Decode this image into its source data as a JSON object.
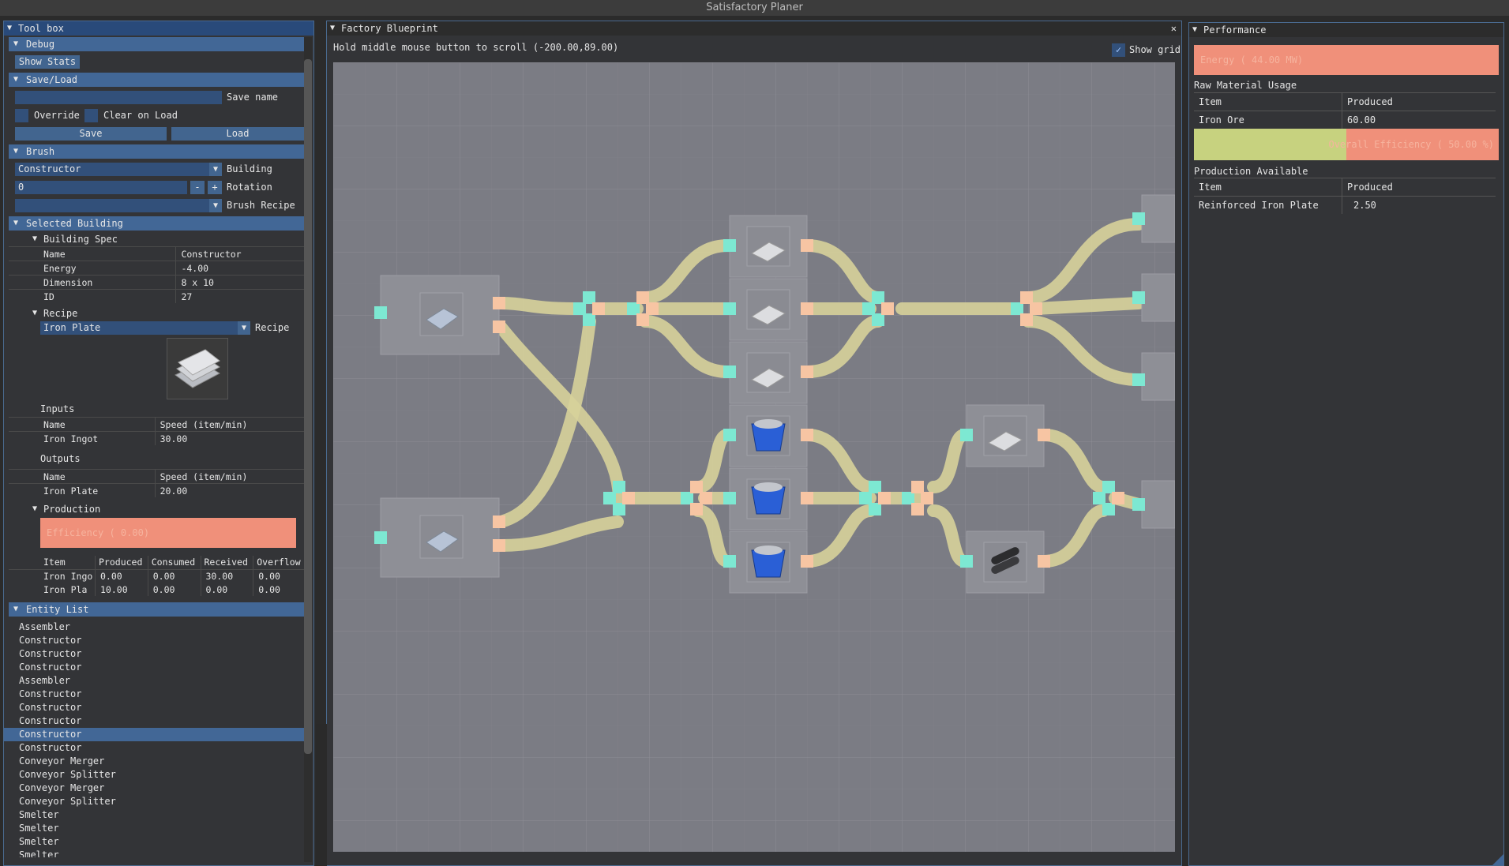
{
  "app": {
    "title": "Satisfactory Planer"
  },
  "toolbox": {
    "title": "Tool box",
    "debug": {
      "header": "Debug",
      "show_stats": "Show Stats"
    },
    "saveload": {
      "header": "Save/Load",
      "save_name_value": "",
      "save_name_label": "Save name",
      "override": "Override",
      "clear_on_load": "Clear on Load",
      "save": "Save",
      "load": "Load"
    },
    "brush": {
      "header": "Brush",
      "building_value": "Constructor",
      "building_label": "Building",
      "rotation_value": "0",
      "minus": "-",
      "plus": "+",
      "rotation_label": "Rotation",
      "recipe_value": "",
      "recipe_label": "Brush Recipe"
    },
    "selected": {
      "header": "Selected Building",
      "spec_header": "Building Spec",
      "spec": [
        {
          "k": "Name",
          "v": "Constructor"
        },
        {
          "k": "Energy",
          "v": "-4.00"
        },
        {
          "k": "Dimension",
          "v": "8 x 10"
        },
        {
          "k": "ID",
          "v": "27"
        }
      ],
      "recipe_header": "Recipe",
      "recipe_value": "Iron Plate",
      "recipe_label": "Recipe",
      "inputs_label": "Inputs",
      "inputs_cols": [
        "Name",
        "Speed (item/min)"
      ],
      "inputs_rows": [
        {
          "k": "Iron Ingot",
          "v": "30.00"
        }
      ],
      "outputs_label": "Outputs",
      "outputs_cols": [
        "Name",
        "Speed (item/min)"
      ],
      "outputs_rows": [
        {
          "k": "Iron Plate",
          "v": "20.00"
        }
      ],
      "production_header": "Production",
      "efficiency": "Efficiency (  0.00)",
      "prod_cols": [
        "Item",
        "Produced",
        "Consumed",
        "Received",
        "Overflow"
      ],
      "prod_rows": [
        [
          "Iron Ingo",
          "0.00",
          "0.00",
          "30.00",
          "0.00"
        ],
        [
          "Iron Pla",
          "10.00",
          "0.00",
          "0.00",
          "0.00"
        ]
      ]
    },
    "entity_list": {
      "header": "Entity List",
      "items": [
        "Assembler",
        "Constructor",
        "Constructor",
        "Constructor",
        "Assembler",
        "Constructor",
        "Constructor",
        "Constructor",
        "Constructor",
        "Constructor",
        "Conveyor Merger",
        "Conveyor Splitter",
        "Conveyor Merger",
        "Conveyor Splitter",
        "Smelter",
        "Smelter",
        "Smelter",
        "Smelter"
      ],
      "selected_index": 8
    }
  },
  "blueprint": {
    "title": "Factory Blueprint",
    "close": "✕",
    "hint": "Hold middle mouse button to scroll (-200.00,89.00)",
    "show_grid": "Show grid"
  },
  "performance": {
    "title": "Performance",
    "energy": "Energy ( 44.00 MW)",
    "raw_header": "Raw Material Usage",
    "raw_cols": [
      "Item",
      "Produced"
    ],
    "raw_rows": [
      {
        "k": "Iron Ore",
        "v": "60.00"
      }
    ],
    "overall": "Overall Efficiency ( 50.00 %)",
    "overall_fraction": 0.5,
    "prod_header": "Production Available",
    "prod_cols": [
      "Item",
      "Produced"
    ],
    "prod_rows": [
      {
        "k": "Reinforced Iron Plate",
        "v": "2.50"
      }
    ]
  },
  "colors": {
    "header_blue": "#426796",
    "grid_bg": "#7b7c84",
    "belt": "#d7d29a",
    "input_port": "#7de8d2",
    "output_port": "#f7c5a3",
    "efficiency_red": "#f0907a",
    "efficiency_green": "#c7d27f"
  },
  "icons": {
    "plate": "iron-plate-icon",
    "ore": "iron-ore-bin-icon",
    "pipe": "steel-pipe-icon",
    "ingot": "iron-ingot-icon"
  }
}
